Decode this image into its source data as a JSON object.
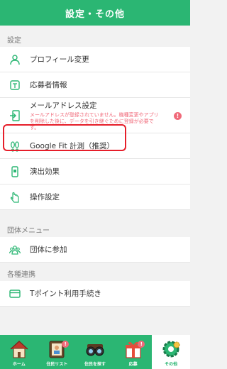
{
  "header": {
    "title": "設定・その他"
  },
  "sections": [
    {
      "title": "設定",
      "items": [
        {
          "label": "プロフィール変更",
          "icon": "person-icon"
        },
        {
          "label": "応募者情報",
          "icon": "applicant-card-icon"
        },
        {
          "label": "メールアドレス設定",
          "icon": "mail-login-icon",
          "warning": "メールアドレスが登録されていません。機種変更やアプリを削除した後に、データを引き継ぐために登録が必要です。",
          "badge": "!"
        },
        {
          "label": "Google Fit 計測（推奨）",
          "icon": "footsteps-icon",
          "highlighted": true
        },
        {
          "label": "演出効果",
          "icon": "phone-effect-icon"
        },
        {
          "label": "操作設定",
          "icon": "hand-tap-icon"
        }
      ]
    },
    {
      "title": "団体メニュー",
      "items": [
        {
          "label": "団体に参加",
          "icon": "group-icon"
        }
      ]
    },
    {
      "title": "各種連携",
      "items": [
        {
          "label": "Tポイント利用手続き",
          "icon": "card-icon"
        }
      ]
    }
  ],
  "bottom_nav": [
    {
      "label": "ホーム",
      "icon": "house-icon",
      "active": false
    },
    {
      "label": "住民リスト",
      "icon": "resident-list-icon",
      "active": false,
      "badge": "!"
    },
    {
      "label": "住民を探す",
      "icon": "binoculars-icon",
      "active": false
    },
    {
      "label": "応募",
      "icon": "gift-icon",
      "active": false,
      "badge": "!"
    },
    {
      "label": "その他",
      "icon": "gear-icon",
      "active": true
    }
  ],
  "colors": {
    "brand": "#2bb673",
    "warning": "#f06a7a",
    "highlight": "#e61e2a"
  }
}
